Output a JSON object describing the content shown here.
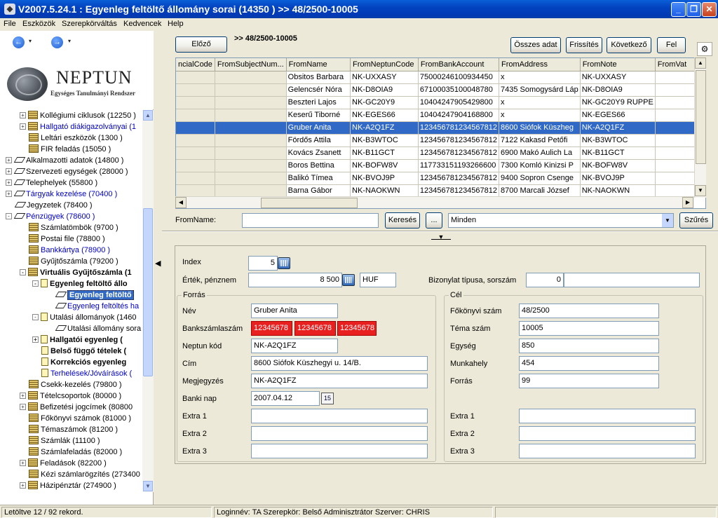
{
  "window": {
    "title": "V2007.5.24.1 : Egyenleg feltöltő állomány sorai (14350  )  >> 48/2500-10005",
    "app_icon": "neptun-app-icon",
    "minimize": "_",
    "maximize": "❐",
    "close": "✕"
  },
  "menu": [
    "File",
    "Eszközök",
    "Szerepkörváltás",
    "Kedvencek",
    "Help"
  ],
  "nav": {
    "back": "←",
    "forward": "→",
    "dropdown": "▾"
  },
  "logo": {
    "name": "NEPTUN",
    "subtitle": "Egységes Tanulmányi Rendszer"
  },
  "tree": [
    {
      "label": "Kollégiumi ciklusok (12250  )",
      "indent": 2,
      "exp": "+",
      "icon": "stack",
      "style": ""
    },
    {
      "label": "Hallgató diákigazolványai (1",
      "indent": 2,
      "exp": "+",
      "icon": "stack",
      "style": "blue"
    },
    {
      "label": "Leltári eszközök (1300  )",
      "indent": 2,
      "exp": "",
      "icon": "stack",
      "style": ""
    },
    {
      "label": "FIR feladás (15050  )",
      "indent": 2,
      "exp": "",
      "icon": "stack",
      "style": ""
    },
    {
      "label": "Alkalmazotti adatok (14800  )",
      "indent": 1,
      "exp": "+",
      "icon": "diamond",
      "style": ""
    },
    {
      "label": "Szervezeti egységek (28000  )",
      "indent": 1,
      "exp": "+",
      "icon": "diamond",
      "style": ""
    },
    {
      "label": "Telephelyek (55800  )",
      "indent": 1,
      "exp": "+",
      "icon": "diamond",
      "style": ""
    },
    {
      "label": "Tárgyak kezelése (70400  )",
      "indent": 1,
      "exp": "+",
      "icon": "diamond",
      "style": "blue"
    },
    {
      "label": "Jegyzetek (78400  )",
      "indent": 1,
      "exp": "",
      "icon": "diamond",
      "style": ""
    },
    {
      "label": "Pénzügyek (78600  )",
      "indent": 1,
      "exp": "-",
      "icon": "diamond",
      "style": "blue"
    },
    {
      "label": "Számlatömbök (9700  )",
      "indent": 2,
      "exp": "",
      "icon": "stack",
      "style": ""
    },
    {
      "label": "Postai file (78800  )",
      "indent": 2,
      "exp": "",
      "icon": "stack",
      "style": ""
    },
    {
      "label": "Bankkártya (78900  )",
      "indent": 2,
      "exp": "",
      "icon": "stack",
      "style": "blue"
    },
    {
      "label": "Gyűjtőszámla (79200  )",
      "indent": 2,
      "exp": "",
      "icon": "stack",
      "style": ""
    },
    {
      "label": "Virtuális Gyűjtőszámla (1",
      "indent": 2,
      "exp": "-",
      "icon": "stack",
      "style": "bold"
    },
    {
      "label": "Egyenleg feltöltő állo",
      "indent": 3,
      "exp": "-",
      "icon": "doc",
      "style": "bold"
    },
    {
      "label": "Egyenleg feltöltő",
      "indent": 4,
      "exp": "",
      "icon": "diamond",
      "style": "bold sel"
    },
    {
      "label": "Egyenleg feltöltés ha",
      "indent": 4,
      "exp": "",
      "icon": "diamond",
      "style": "blue"
    },
    {
      "label": "Utalási állományok (1460",
      "indent": 3,
      "exp": "-",
      "icon": "doc",
      "style": ""
    },
    {
      "label": "Utalási állomány sora",
      "indent": 4,
      "exp": "",
      "icon": "diamond",
      "style": ""
    },
    {
      "label": "Hallgatói egyenleg (",
      "indent": 3,
      "exp": "+",
      "icon": "doc",
      "style": "bold"
    },
    {
      "label": "Belső függő tételek (",
      "indent": 3,
      "exp": "",
      "icon": "doc",
      "style": "bold"
    },
    {
      "label": "Korrekciós egyenleg",
      "indent": 3,
      "exp": "",
      "icon": "doc",
      "style": "bold"
    },
    {
      "label": "Terhelések/Jóváírások (",
      "indent": 3,
      "exp": "",
      "icon": "doc",
      "style": "blue"
    },
    {
      "label": "Csekk-kezelés (79800  )",
      "indent": 2,
      "exp": "",
      "icon": "stack",
      "style": ""
    },
    {
      "label": "Tételcsoportok (80000  )",
      "indent": 2,
      "exp": "+",
      "icon": "stack",
      "style": ""
    },
    {
      "label": "Befizetési jogcímek (80800",
      "indent": 2,
      "exp": "+",
      "icon": "stack",
      "style": ""
    },
    {
      "label": "Főkönyvi számok (81000  )",
      "indent": 2,
      "exp": "",
      "icon": "stack",
      "style": ""
    },
    {
      "label": "Témaszámok (81200  )",
      "indent": 2,
      "exp": "",
      "icon": "stack",
      "style": ""
    },
    {
      "label": "Számlák (11100  )",
      "indent": 2,
      "exp": "",
      "icon": "stack",
      "style": ""
    },
    {
      "label": "Számlafeladás (82000  )",
      "indent": 2,
      "exp": "",
      "icon": "stack",
      "style": ""
    },
    {
      "label": "Feladások (82200  )",
      "indent": 2,
      "exp": "+",
      "icon": "stack",
      "style": ""
    },
    {
      "label": "Kézi számlarögzítés (273400",
      "indent": 2,
      "exp": "",
      "icon": "stack",
      "style": ""
    },
    {
      "label": "Házipénztár (274900  )",
      "indent": 2,
      "exp": "+",
      "icon": "stack",
      "style": ""
    }
  ],
  "toolbar": {
    "prev": "Előző",
    "path": ">> 48/2500-10005",
    "all_data": "Összes adat",
    "refresh": "Frissítés",
    "next": "Következő",
    "up": "Fel"
  },
  "grid": {
    "columns": [
      "ncialCode",
      "FromSubjectNum...",
      "FromName",
      "FromNeptunCode",
      "FromBankAccount",
      "FromAddress",
      "FromNote",
      "FromVat"
    ],
    "rows": [
      [
        "",
        "",
        "Obsitos Barbara",
        "NK-UXXASY",
        "75000246100934450",
        "x",
        "NK-UXXASY",
        ""
      ],
      [
        "",
        "",
        "Gelencsér Nóra",
        "NK-D8OIA9",
        "67100035100048780",
        "7435 Somogysárd Láp",
        "NK-D8OIA9",
        ""
      ],
      [
        "",
        "",
        "Beszteri Lajos",
        "NK-GC20Y9",
        "10404247905429800",
        "x",
        "NK-GC20Y9 RUPPE",
        ""
      ],
      [
        "",
        "",
        "Keserű Tiborné",
        "NK-EGES66",
        "10404247904168800",
        "x",
        "NK-EGES66",
        ""
      ],
      [
        "",
        "",
        "Gruber Anita",
        "NK-A2Q1FZ",
        "123456781234567812",
        "8600 Siófok Küszheg",
        "NK-A2Q1FZ",
        ""
      ],
      [
        "",
        "",
        "Fördős Attila",
        "NK-B3WTOC",
        "123456781234567812",
        "7122 Kakasd Petőfi",
        "NK-B3WTOC",
        ""
      ],
      [
        "",
        "",
        "Kovács Zsanett",
        "NK-B11GCT",
        "123456781234567812",
        "6900 Makó Aulich La",
        "NK-B11GCT",
        ""
      ],
      [
        "",
        "",
        "Boros Bettina",
        "NK-BOFW8V",
        "117733151193266600",
        "7300 Komló Kinizsi P",
        "NK-BOFW8V",
        ""
      ],
      [
        "",
        "",
        "Balikó Tímea",
        "NK-BVOJ9P",
        "123456781234567812",
        "9400 Sopron Csenge",
        "NK-BVOJ9P",
        ""
      ],
      [
        "",
        "",
        "Barna Gábor",
        "NK-NAOKWN",
        "123456781234567812",
        "8700 Marcali József",
        "NK-NAOKWN",
        ""
      ]
    ],
    "selected_row": 4
  },
  "filter": {
    "label": "FromName:",
    "value": "",
    "search": "Keresés",
    "ellipsis": "...",
    "combo_value": "Minden",
    "apply": "Szűrés"
  },
  "detail": {
    "index_label": "Index",
    "index_value": "5",
    "value_label": "Érték, pénznem",
    "value_amount": "8 500",
    "currency": "HUF",
    "doc_label": "Bizonylat típusa, sorszám",
    "doc_type": "0",
    "doc_number": "",
    "source": {
      "legend": "Forrás",
      "name_label": "Név",
      "name": "Gruber Anita",
      "bank_label": "Bankszámlaszám",
      "bank1": "12345678",
      "bank2": "12345678",
      "bank3": "12345678",
      "neptun_label": "Neptun kód",
      "neptun": "NK-A2Q1FZ",
      "address_label": "Cím",
      "address": "8600 Siófok Küszhegyi u. 14/B.",
      "note_label": "Megjegyzés",
      "note": "NK-A2Q1FZ",
      "bankday_label": "Banki nap",
      "bankday": "2007.04.12",
      "extra1_label": "Extra 1",
      "extra1": "",
      "extra2_label": "Extra 2",
      "extra2": "",
      "extra3_label": "Extra 3",
      "extra3": ""
    },
    "target": {
      "legend": "Cél",
      "ledger_label": "Főkönyvi szám",
      "ledger": "48/2500",
      "topic_label": "Téma szám",
      "topic": "10005",
      "unit_label": "Egység",
      "unit": "850",
      "workplace_label": "Munkahely",
      "workplace": "454",
      "source_label": "Forrás",
      "source": "99",
      "extra1_label": "Extra 1",
      "extra1": "",
      "extra2_label": "Extra 2",
      "extra2": "",
      "extra3_label": "Extra 3",
      "extra3": ""
    }
  },
  "status": {
    "records": "Letöltve 12 / 92 rekord.",
    "session": "Loginnév: TA   Szerepkör: Belső Adminisztrátor   Szerver: CHRIS"
  }
}
